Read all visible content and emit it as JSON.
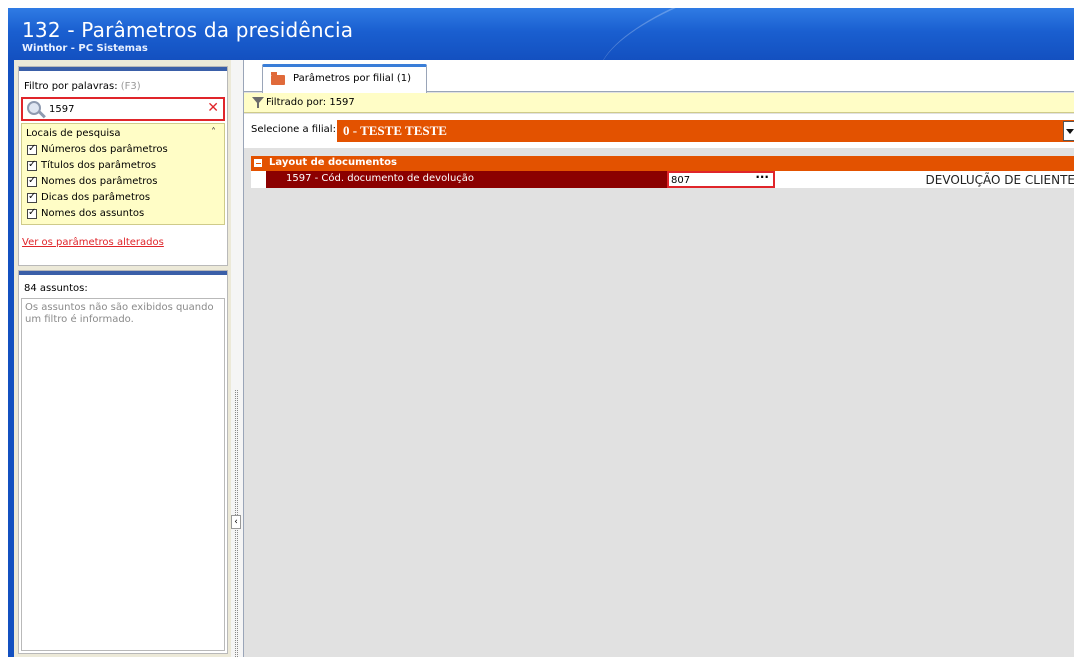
{
  "window": {
    "title": "132 - Parâmetros da presidência",
    "subtitle": "Winthor - PC Sistemas"
  },
  "left": {
    "filter_label": "Filtro por palavras:",
    "filter_hint": "(F3)",
    "search_value": "1597",
    "search_icon": "search-icon",
    "clear_icon": "close-icon",
    "locais_title": "Locais de pesquisa",
    "locais_collapse_icon": "chevron-double-up-icon",
    "checkboxes": [
      {
        "label": "Números dos parâmetros",
        "checked": true
      },
      {
        "label": "Títulos dos parâmetros",
        "checked": true
      },
      {
        "label": "Nomes dos parâmetros",
        "checked": true
      },
      {
        "label": "Dicas dos parâmetros",
        "checked": true
      },
      {
        "label": "Nomes dos assuntos",
        "checked": true
      }
    ],
    "altered_link": "Ver os parâmetros alterados",
    "subjects_label": "84 assuntos:",
    "subjects_message": "Os assuntos não são exibidos quando um filtro é informado."
  },
  "right": {
    "tab_label": "Parâmetros por filial  (1)",
    "filtered_by": "Filtrado por: 1597",
    "branch_label": "Selecione a filial:",
    "branch_value": "0 - TESTE TESTE",
    "group_label": "Layout de documentos",
    "param": {
      "name": "1597 - Cód. documento de devolução",
      "value": "807",
      "button": "···",
      "description": "DEVOLUÇÃO DE CLIENTE"
    }
  },
  "colors": {
    "title_bar": "#1a5fd0",
    "accent_orange": "#e35200",
    "row_dark_red": "#8b0000",
    "highlight_red": "#e0252a",
    "filter_yellow": "#fffdc6"
  }
}
